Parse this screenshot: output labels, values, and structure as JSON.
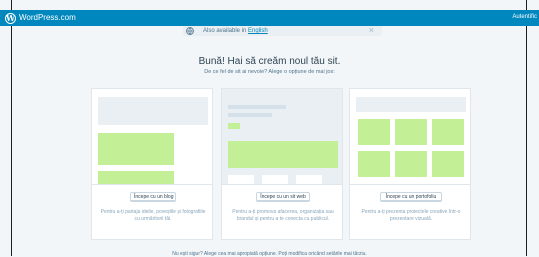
{
  "topbar": {
    "brand": "WordPress.com",
    "logo_letter": "W",
    "login": "Autentific"
  },
  "notice": {
    "prefix": "Also available in ",
    "link": "English",
    "close": "×"
  },
  "heading": {
    "title": "Bună! Hai să creăm noul tău sit.",
    "subtitle": "De ce fel de sit ai nevoie? Alege o opțiune de mai jos:"
  },
  "cards": [
    {
      "button": "Începe cu un blog",
      "description": "Pentru a-ți partaja ideile, poveștile și fotografiile cu urmăritorii tăi."
    },
    {
      "button": "Începe cu un sit web",
      "description": "Pentru a-ți promova afacerea, organizația sau brandul și pentru a te conecta cu publicul."
    },
    {
      "button": "Începe cu un portofoliu",
      "description": "Pentru a-ți prezenta proiectele creative într-o prezentare vizuală."
    }
  ],
  "footer": "Nu ești sigur? Alege cea mai apropiată opțiune. Poți modifica oricând setările mai târziu.",
  "colors": {
    "topbar": "#0087be",
    "background": "#f3f6f8",
    "placeholder_green": "#c3ef96",
    "placeholder_gray": "#e9eff3"
  }
}
